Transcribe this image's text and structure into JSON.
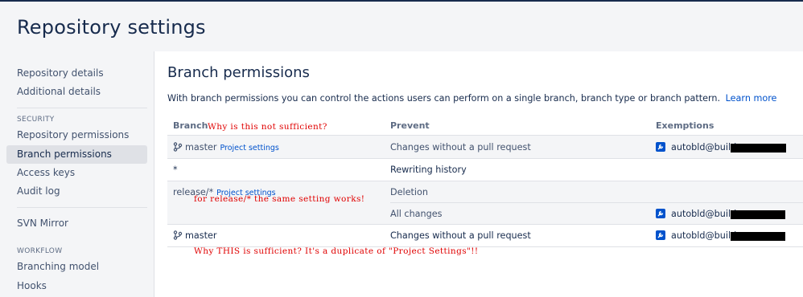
{
  "header": {
    "title": "Repository settings"
  },
  "sidebar": {
    "group1": [
      "Repository details",
      "Additional details"
    ],
    "security_heading": "SECURITY",
    "security_items": [
      "Repository permissions",
      "Branch permissions",
      "Access keys",
      "Audit log"
    ],
    "svn": "SVN Mirror",
    "workflow_heading": "WORKFLOW",
    "workflow_items": [
      "Branching model",
      "Hooks"
    ]
  },
  "main": {
    "title": "Branch permissions",
    "description": "With branch permissions you can control the actions users can perform on a single branch, branch type or branch pattern.",
    "learn_more": "Learn more",
    "columns": {
      "branch": "Branch",
      "prevent": "Prevent",
      "exemptions": "Exemptions"
    },
    "rows": [
      {
        "branch": "master",
        "tag": "Project settings",
        "prevent": "Changes without a pull request",
        "exemption": "autobld@build"
      },
      {
        "branch": "*",
        "prevent": "Rewriting history"
      },
      {
        "branch": "release/*",
        "tag": "Project settings",
        "prevent": "Deletion"
      },
      {
        "prevent": "All changes",
        "exemption": "autobld@build"
      },
      {
        "branch": "master",
        "prevent": "Changes without a pull request",
        "exemption": "autobld@build"
      }
    ]
  },
  "annotations": {
    "header_note": "Why is this not sufficient?",
    "release_note": "for release/* the same setting works!",
    "bottom_note": "Why THIS is sufficient? It's a duplicate of \"Project Settings\"!!"
  },
  "colors": {
    "accent": "#0052cc",
    "annotation": "#e00000",
    "text": "#172b4d"
  }
}
